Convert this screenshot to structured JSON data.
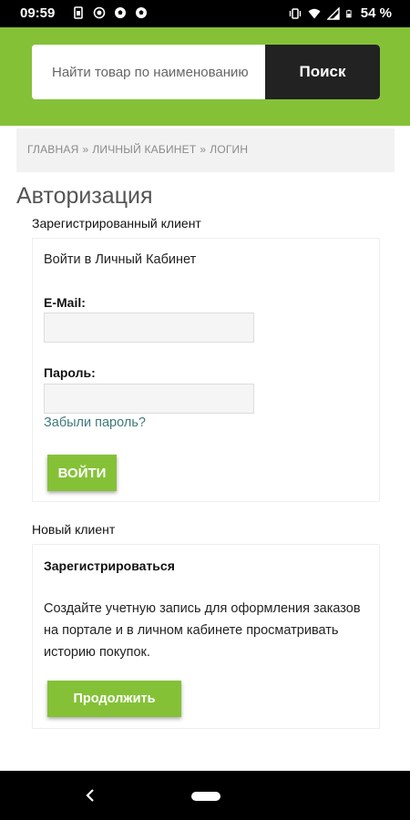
{
  "status_bar": {
    "time": "09:59",
    "battery_percent": "54 %",
    "icons_left": [
      "sim-card-icon",
      "brightness-icon",
      "soccer-ball-icon",
      "soccer-ball-icon"
    ],
    "icons_right": [
      "vibrate-icon",
      "wifi-icon",
      "signal-icon",
      "battery-icon"
    ]
  },
  "search": {
    "placeholder": "Найти товар по наименованию",
    "button_label": "Поиск"
  },
  "breadcrumb": {
    "items": [
      "ГЛАВНАЯ",
      "ЛИЧНЫЙ КАБИНЕТ",
      "ЛОГИН"
    ],
    "separator": "»"
  },
  "page_title": "Авторизация",
  "registered": {
    "section_title": "Зарегистрированный клиент",
    "lead": "Войти в Личный Кабинет",
    "email_label": "E-Mail:",
    "email_value": "",
    "password_label": "Пароль:",
    "password_value": "",
    "forgot_link": "Забыли пароль?",
    "login_button": "ВОЙТИ"
  },
  "new_client": {
    "section_title": "Новый клиент",
    "heading": "Зарегистрироваться",
    "description": "Создайте учетную запись для оформления заказов на портале и в личном кабинете просматривать историю покупок.",
    "continue_button": "Продолжить"
  },
  "colors": {
    "accent_green": "#85c137",
    "search_button": "#222222",
    "link": "#3f7a7a"
  }
}
